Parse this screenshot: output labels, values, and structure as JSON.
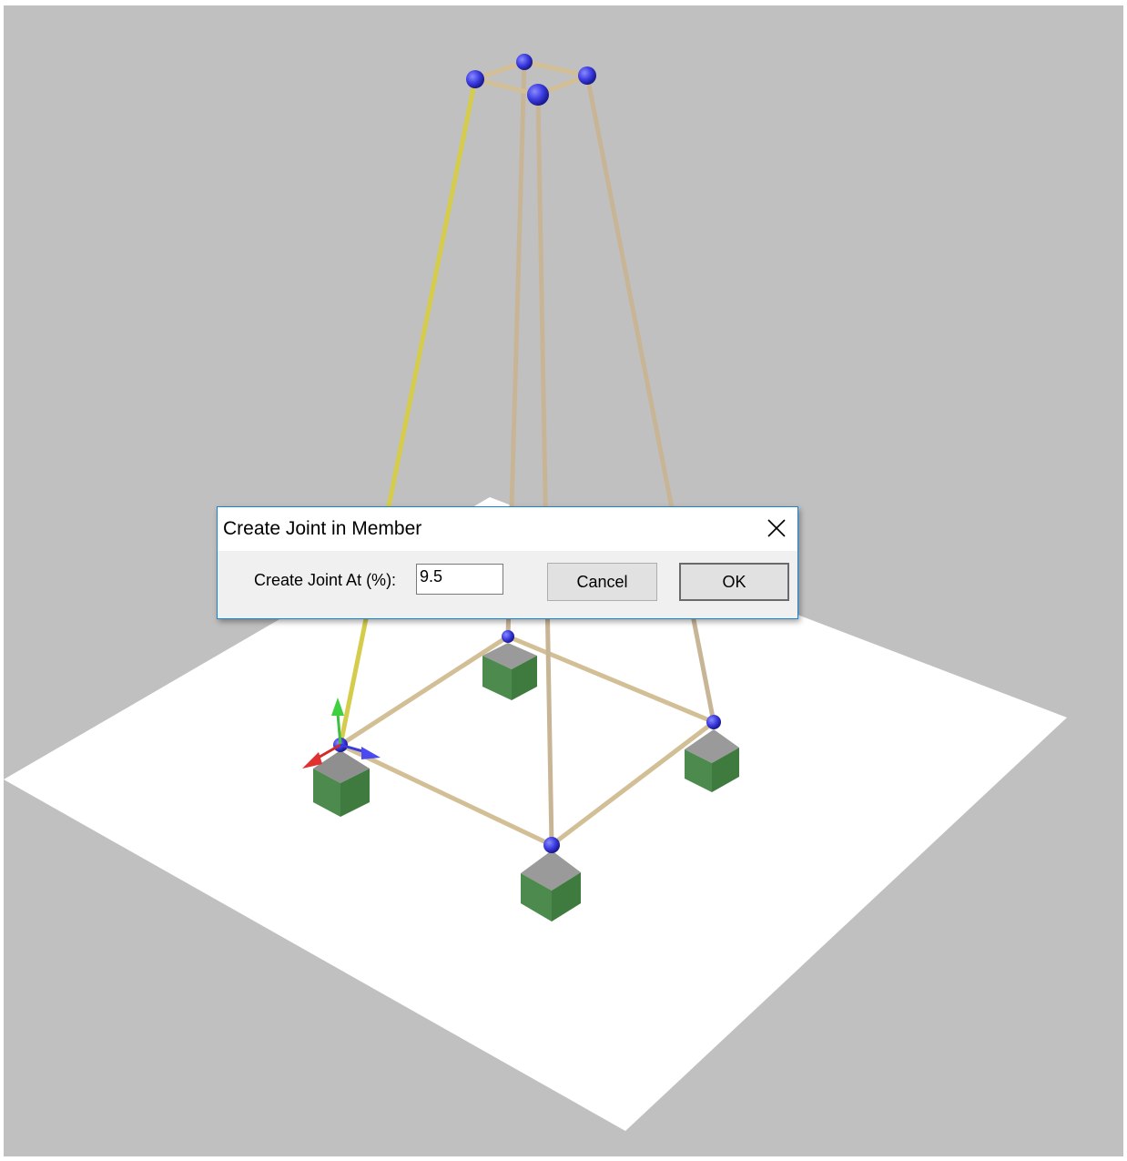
{
  "dialog": {
    "title": "Create Joint in Member",
    "field_label": "Create Joint At (%):",
    "field_value": "9.5",
    "cancel_label": "Cancel",
    "ok_label": "OK"
  },
  "scene": {
    "background_color": "#c0c0c0",
    "ground_color": "#ffffff",
    "member_color": "#d2bf96",
    "selected_member_color": "#d4cc4a",
    "joint_color": "#3a3ae0",
    "support_top_color": "#8a8a8a",
    "support_body_color": "#4f8a4f"
  },
  "icons": {
    "close": "close-icon",
    "axis_triad": "axis-triad-icon"
  }
}
